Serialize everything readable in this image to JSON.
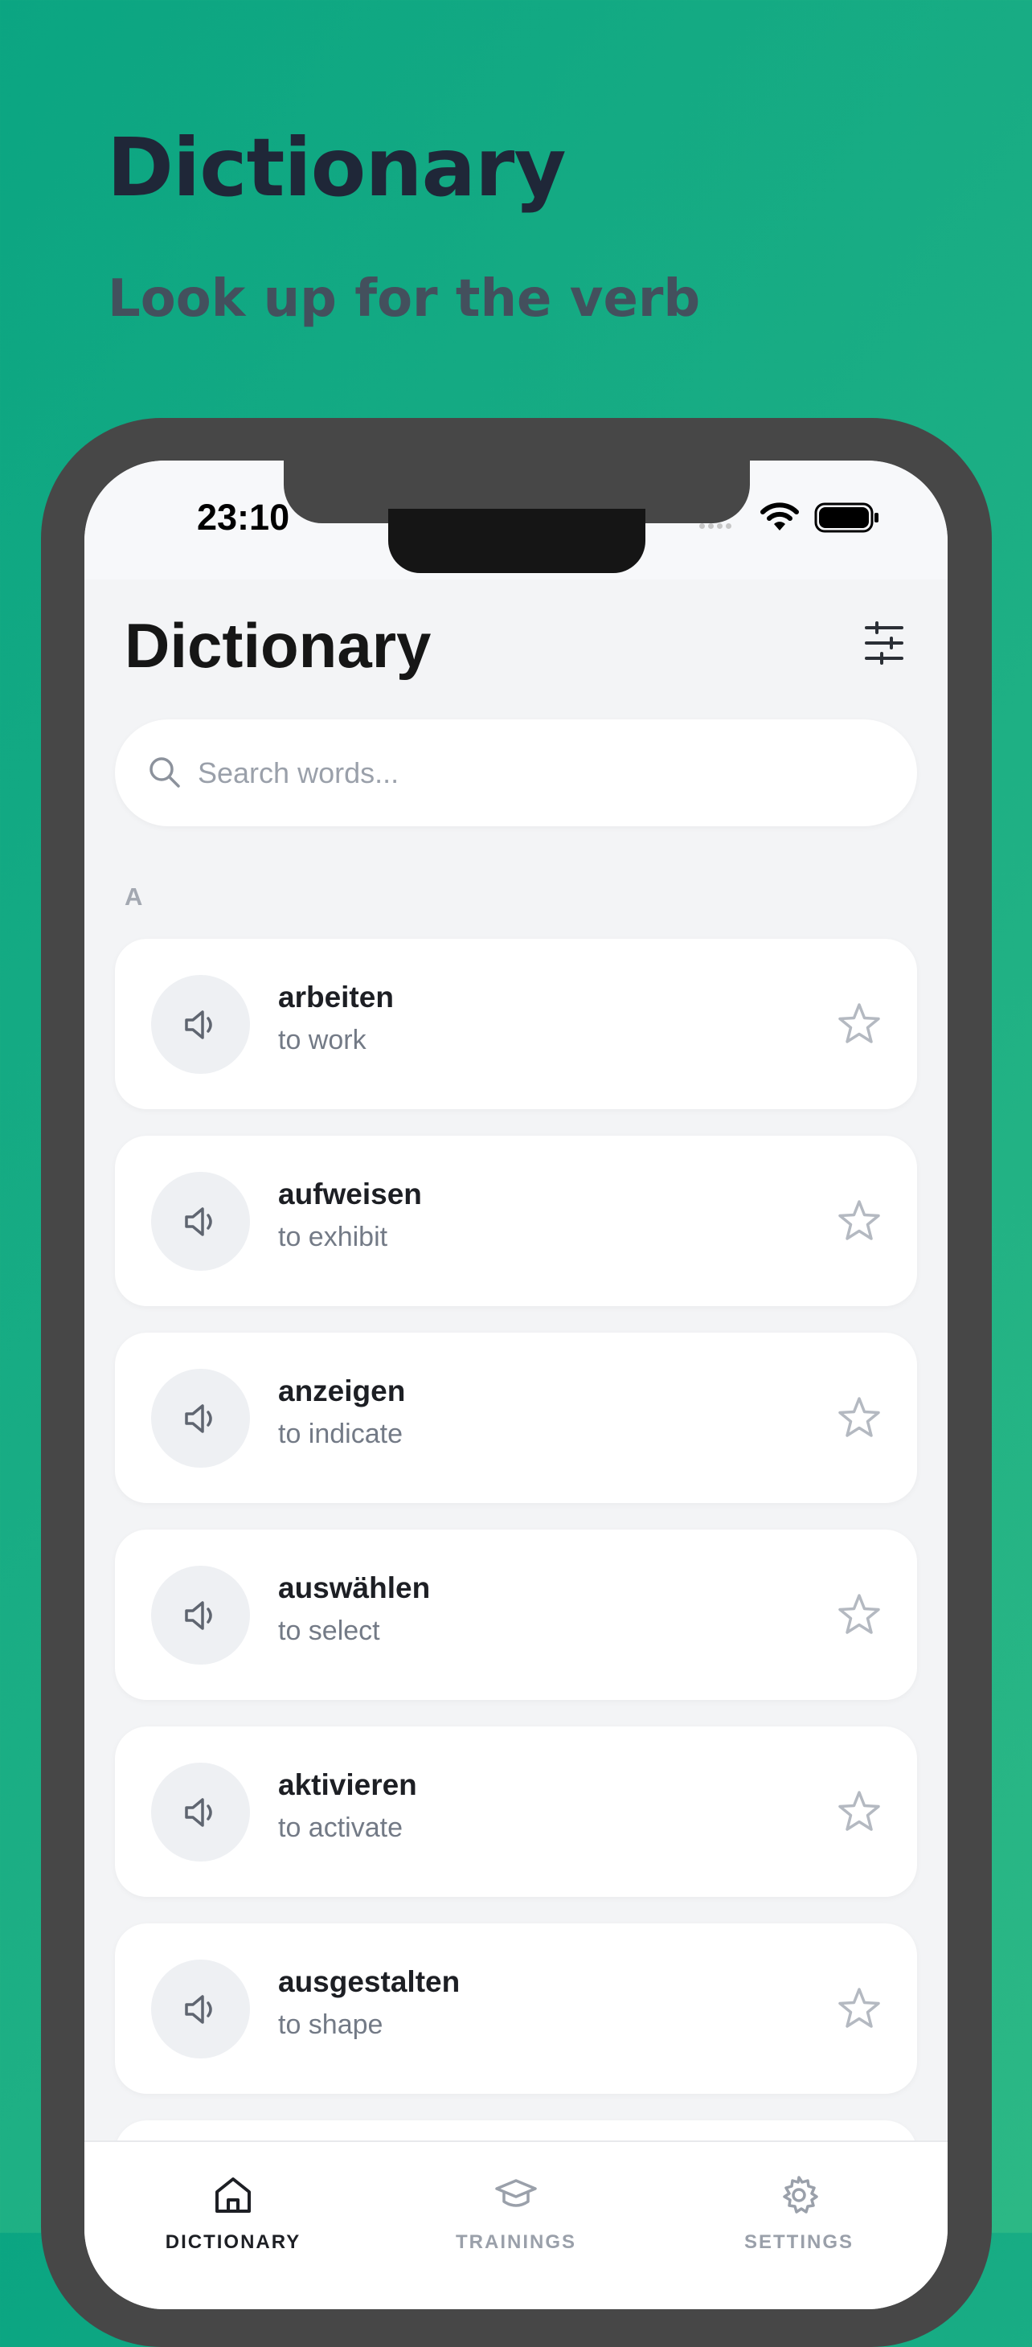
{
  "promo": {
    "title": "Dictionary",
    "subtitle": "Look up for the verb"
  },
  "status_bar": {
    "time": "23:10"
  },
  "header": {
    "title": "Dictionary"
  },
  "search": {
    "placeholder": "Search words...",
    "value": ""
  },
  "section": {
    "letter": "A"
  },
  "words": [
    {
      "word": "arbeiten",
      "translation": "to work"
    },
    {
      "word": "aufweisen",
      "translation": "to exhibit"
    },
    {
      "word": "anzeigen",
      "translation": "to indicate"
    },
    {
      "word": "auswählen",
      "translation": "to select"
    },
    {
      "word": "aktivieren",
      "translation": "to activate"
    },
    {
      "word": "ausgestalten",
      "translation": "to shape"
    }
  ],
  "tabs": [
    {
      "label": "DICTIONARY",
      "icon": "home-icon",
      "active": true
    },
    {
      "label": "TRAININGS",
      "icon": "graduation-cap-icon",
      "active": false
    },
    {
      "label": "SETTINGS",
      "icon": "gear-icon",
      "active": false
    }
  ],
  "colors": {
    "background_gradient_start": "#0ba582",
    "background_gradient_end": "#2cb885",
    "phone_frame": "#474747",
    "screen_background": "#f3f4f6",
    "active_tab": "#1d1f24",
    "inactive_tab": "#9aa0aa"
  }
}
